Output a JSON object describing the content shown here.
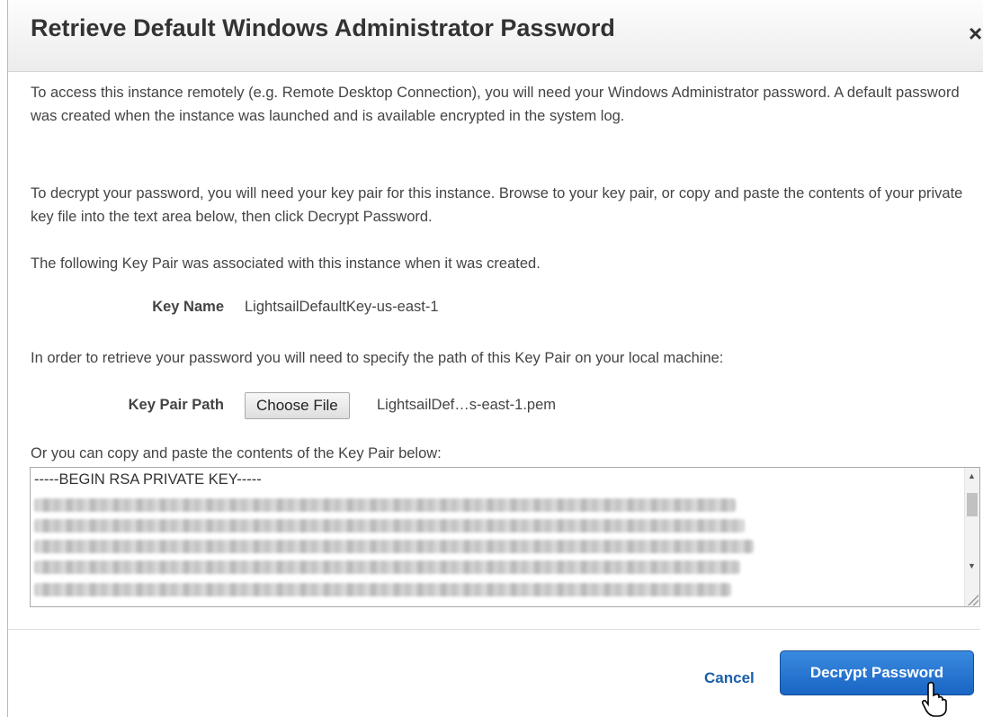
{
  "dialog": {
    "title": "Retrieve Default Windows Administrator Password",
    "close_label": "×"
  },
  "body": {
    "paragraph_1": "To access this instance remotely (e.g. Remote Desktop Connection), you will need your Windows Administrator password. A default password was created when the instance was launched and is available encrypted in the system log.",
    "paragraph_2": "To decrypt your password, you will need your key pair for this instance. Browse to your key pair, or copy and paste the contents of your private key file into the text area below, then click Decrypt Password.",
    "paragraph_3": "The following Key Pair was associated with this instance when it was created.",
    "key_name_label": "Key Name",
    "key_name_value": "LightsailDefaultKey-us-east-1",
    "paragraph_4": "In order to retrieve your password you will need to specify the path of this Key Pair on your local machine:",
    "key_pair_path_label": "Key Pair Path",
    "choose_file_label": "Choose File",
    "selected_file": "LightsailDef…s-east-1.pem",
    "paragraph_5": "Or you can copy and paste the contents of the Key Pair below:",
    "key_textarea_first_line": "-----BEGIN RSA PRIVATE KEY-----"
  },
  "footer": {
    "cancel_label": "Cancel",
    "decrypt_label": "Decrypt Password"
  },
  "icons": {
    "close": "close-icon",
    "scroll_up": "scroll-up-arrow-icon",
    "scroll_down": "scroll-down-arrow-icon",
    "resize": "resize-grip-icon",
    "cursor": "hand-pointer-icon"
  },
  "colors": {
    "primary_button": "#1965c3",
    "link": "#1a5fa8",
    "header_bg": "#ececec"
  }
}
